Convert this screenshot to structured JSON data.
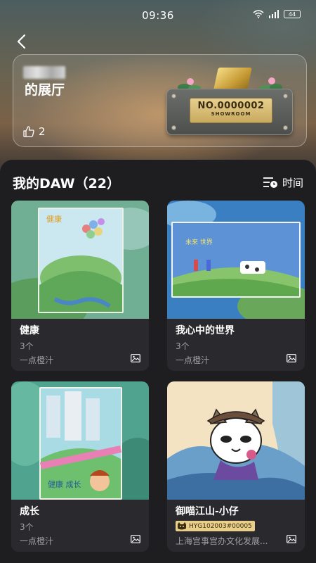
{
  "status": {
    "time": "09:36",
    "battery": "44"
  },
  "hall": {
    "title": "的展厅",
    "likes": "2",
    "plaque_number": "NO.0000002",
    "plaque_label": "SHOWROOM"
  },
  "section": {
    "title": "我的DAW（22）",
    "sort_label": "时间"
  },
  "cards": [
    {
      "name": "健康",
      "count": "3个",
      "author": "一点橙汁"
    },
    {
      "name": "我心中的世界",
      "count": "3个",
      "author": "一点橙汁"
    },
    {
      "name": "成长",
      "count": "3个",
      "author": "一点橙汁"
    },
    {
      "name": "御喵江山-小仔",
      "badge": "HYG102003#00005",
      "author": "上海宫事宫办文化发展..."
    }
  ],
  "colors": {
    "accent_gold": "#e9cf8a",
    "background": "#1e1e21",
    "card": "#2a2a2e"
  }
}
